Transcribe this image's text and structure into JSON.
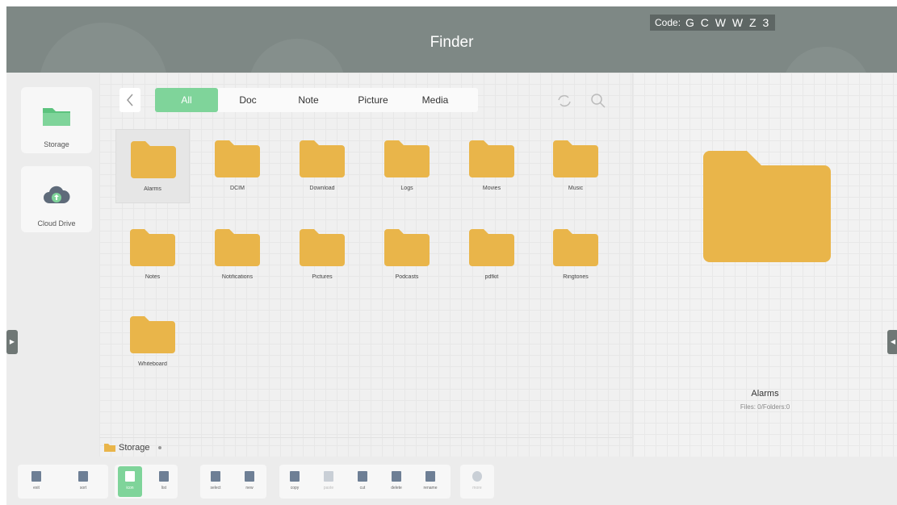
{
  "header": {
    "title": "Finder",
    "code_label": "Code:",
    "code_value": "G C W W Z 3"
  },
  "sidebar": {
    "items": [
      {
        "label": "Storage",
        "icon": "folder-icon"
      },
      {
        "label": "Cloud Drive",
        "icon": "cloud-upload-icon"
      }
    ]
  },
  "tabs": [
    "All",
    "Doc",
    "Note",
    "Picture",
    "Media"
  ],
  "active_tab": "All",
  "folders": [
    {
      "name": "Alarms"
    },
    {
      "name": "DCIM"
    },
    {
      "name": "Download"
    },
    {
      "name": "Logs"
    },
    {
      "name": "Movies"
    },
    {
      "name": "Music"
    },
    {
      "name": "Notes"
    },
    {
      "name": "Notifications"
    },
    {
      "name": "Pictures"
    },
    {
      "name": "Podcasts"
    },
    {
      "name": "pdfkit"
    },
    {
      "name": "Ringtones"
    },
    {
      "name": "Whiteboard"
    }
  ],
  "selected_folder": "Alarms",
  "path": {
    "current": "Storage"
  },
  "detail": {
    "name": "Alarms",
    "subtitle": "Files: 0/Folders:0"
  },
  "bottom_toolbar": {
    "groups": [
      [
        {
          "label": "exit",
          "icon": "exit-icon"
        },
        {
          "label": "sort",
          "icon": "sort-icon"
        }
      ],
      [
        {
          "label": "icon",
          "icon": "grid-view-icon",
          "active": true
        },
        {
          "label": "list",
          "icon": "list-view-icon"
        }
      ],
      [
        {
          "label": "select",
          "icon": "select-icon"
        },
        {
          "label": "new",
          "icon": "new-folder-icon"
        }
      ],
      [
        {
          "label": "copy",
          "icon": "copy-icon"
        },
        {
          "label": "paste",
          "icon": "paste-icon",
          "disabled": true
        },
        {
          "label": "cut",
          "icon": "cut-icon"
        },
        {
          "label": "delete",
          "icon": "delete-icon"
        },
        {
          "label": "rename",
          "icon": "rename-icon"
        }
      ],
      [
        {
          "label": "more",
          "icon": "more-icon",
          "disabled": true
        }
      ]
    ]
  },
  "colors": {
    "accent_green": "#7fd49a",
    "folder_yellow": "#e9b54a",
    "header_gray": "#7e8885"
  }
}
